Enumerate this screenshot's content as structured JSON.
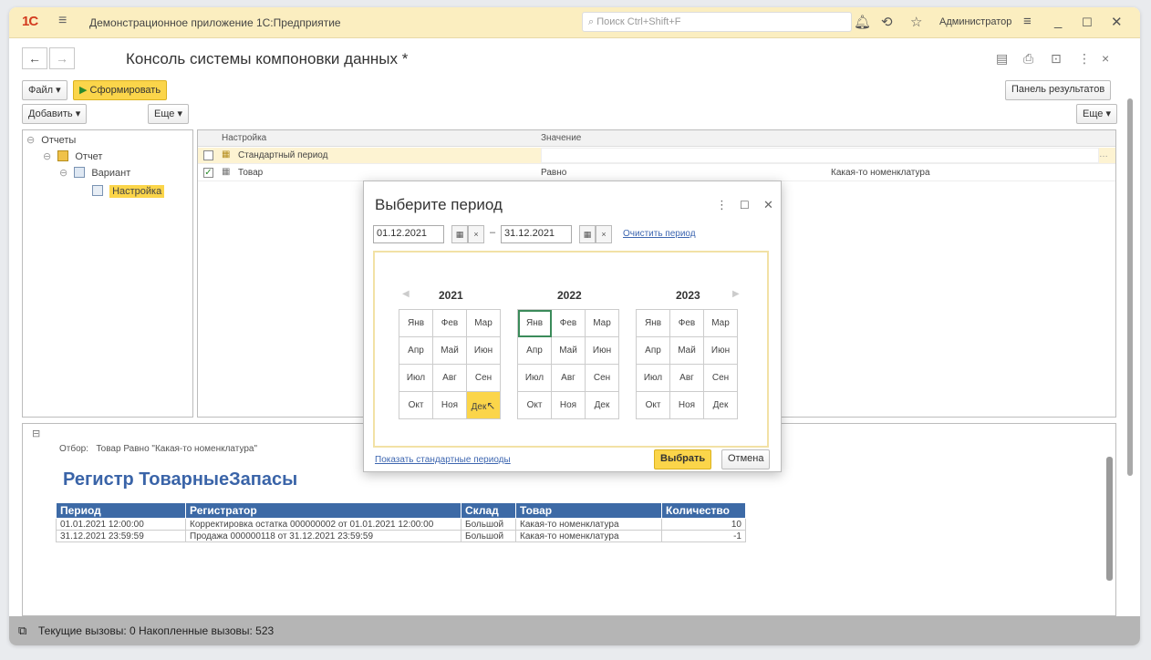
{
  "titlebar": {
    "logo": "1С",
    "app_title": "Демонстрационное приложение 1С:Предприятие",
    "search_placeholder": "Поиск Ctrl+Shift+F",
    "user": "Администратор"
  },
  "form": {
    "title": "Консоль системы компоновки данных *",
    "file_label": "Файл",
    "generate_label": "Сформировать",
    "results_panel_label": "Панель результатов",
    "add_label": "Добавить",
    "more_label": "Еще",
    "more_right_label": "Еще"
  },
  "tree": {
    "items": [
      {
        "label": "Отчеты"
      },
      {
        "label": "Отчет"
      },
      {
        "label": "Вариант"
      },
      {
        "label": "Настройка"
      }
    ]
  },
  "settings_grid": {
    "headers": [
      "Настройка",
      "Значение"
    ],
    "rows": [
      {
        "setting": "Стандартный период",
        "value": "",
        "extra": "",
        "checked": false
      },
      {
        "setting": "Товар",
        "value": "Равно",
        "extra": "Какая-то номенклатура",
        "checked": true
      }
    ]
  },
  "result": {
    "filter_label": "Отбор:",
    "filter_value": "Товар Равно \"Какая-то номенклатура\"",
    "title": "Регистр ТоварныеЗапасы",
    "table": {
      "headers": [
        "Период",
        "Регистратор",
        "Склад",
        "Товар",
        "Количество"
      ],
      "rows": [
        [
          "01.01.2021 12:00:00",
          "Корректировка остатка 000000002 от 01.01.2021 12:00:00",
          "Большой",
          "Какая-то номенклатура",
          "10"
        ],
        [
          "31.12.2021 23:59:59",
          "Продажа 000000118 от 31.12.2021 23:59:59",
          "Большой",
          "Какая-то номенклатура",
          "-1"
        ]
      ]
    }
  },
  "statusbar": {
    "text": "Текущие вызовы: 0   Накопленные вызовы: 523"
  },
  "dialog": {
    "title": "Выберите период",
    "date_from": "01.12.2021",
    "date_to": "31.12.2021",
    "dash": "–",
    "clear_link": "Очистить период",
    "years": [
      "2021",
      "2022",
      "2023"
    ],
    "months": [
      "Янв",
      "Фев",
      "Мар",
      "Апр",
      "Май",
      "Июн",
      "Июл",
      "Авг",
      "Сен",
      "Окт",
      "Ноя",
      "Дек"
    ],
    "show_standard_link": "Показать стандартные периоды",
    "select_label": "Выбрать",
    "cancel_label": "Отмена"
  },
  "colors": {
    "accent_yellow": "#fbd54a",
    "titlebar_bg": "#fbeec0",
    "report_header": "#3d6aa6",
    "report_title": "#3a64a8"
  }
}
